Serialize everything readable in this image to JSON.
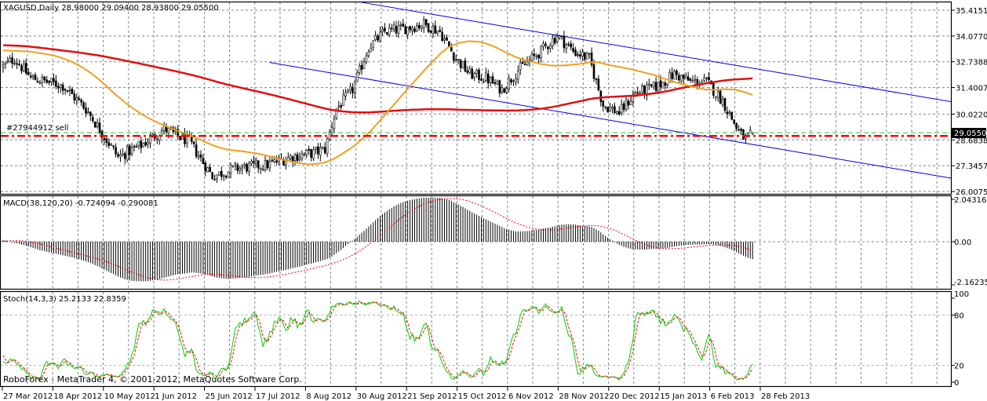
{
  "header": {
    "symbol": "XAGUSD,Daily",
    "open": "28.98000",
    "high": "29.09400",
    "low": "28.93800",
    "close": "29.05500"
  },
  "order_label": "#27944912 sell",
  "current_price_label": "29.05500",
  "copyright": "RoboForex - MetaTrader 4, © 2001-2012, MetaQuotes Software Corp.",
  "colors": {
    "ma_slow": "#e01010",
    "ma_fast": "#f0a020",
    "trendline": "#0000e0",
    "order_line": "#ff0000",
    "bid_line": "#30c030",
    "stoch_main": "#00d000",
    "stoch_signal": "#ff0000",
    "macd_hist": "#000000",
    "macd_signal": "#ff0000"
  },
  "chart_data": [
    {
      "type": "candlestick",
      "title": "XAGUSD,Daily",
      "price_ticks": [
        "35.41515",
        "34.07700",
        "32.73885",
        "31.40070",
        "30.02200",
        "28.68385",
        "27.34570",
        "26.00755"
      ],
      "ylim": [
        26.00755,
        35.41515
      ],
      "x_ticks": [
        "27 Mar 2012",
        "18 Apr 2012",
        "10 May 2012",
        "1 Jun 2012",
        "25 Jun 2012",
        "17 Jul 2012",
        "8 Aug 2012",
        "30 Aug 2012",
        "21 Sep 2012",
        "15 Oct 2012",
        "6 Nov 2012",
        "28 Nov 2012",
        "20 Dec 2012",
        "15 Jan 2013",
        "6 Feb 2013",
        "28 Feb 2013"
      ],
      "bars_per_tick": 22,
      "close_keypoints": [
        [
          0,
          32.5
        ],
        [
          5,
          32.9
        ],
        [
          12,
          31.9
        ],
        [
          26,
          31.5
        ],
        [
          36,
          30.3
        ],
        [
          50,
          27.8
        ],
        [
          60,
          28.4
        ],
        [
          70,
          29.25
        ],
        [
          81,
          28.6
        ],
        [
          91,
          26.8
        ],
        [
          101,
          27.2
        ],
        [
          115,
          27.4
        ],
        [
          125,
          27.8
        ],
        [
          135,
          28.0
        ],
        [
          140,
          28.2
        ],
        [
          145,
          30.3
        ],
        [
          152,
          31.3
        ],
        [
          159,
          33.5
        ],
        [
          166,
          34.3
        ],
        [
          176,
          34.5
        ],
        [
          183,
          34.7
        ],
        [
          190,
          34.3
        ],
        [
          197,
          32.9
        ],
        [
          203,
          32.1
        ],
        [
          210,
          31.9
        ],
        [
          217,
          31.3
        ],
        [
          224,
          32.3
        ],
        [
          234,
          33.3
        ],
        [
          241,
          34.1
        ],
        [
          248,
          33.3
        ],
        [
          255,
          32.9
        ],
        [
          261,
          30.5
        ],
        [
          268,
          30.1
        ],
        [
          275,
          31.1
        ],
        [
          285,
          31.5
        ],
        [
          292,
          32.1
        ],
        [
          299,
          31.7
        ],
        [
          306,
          31.7
        ],
        [
          313,
          30.7
        ],
        [
          320,
          29.1
        ],
        [
          323,
          28.7
        ],
        [
          326,
          29.055
        ]
      ],
      "last_bar": {
        "open": 28.98,
        "high": 29.094,
        "low": 28.938,
        "close": 29.055
      },
      "prehistory_level": 33.9,
      "moving_averages": [
        {
          "name": "MA slow",
          "period": 200
        },
        {
          "name": "MA fast",
          "period": 50
        }
      ],
      "trendlines": [
        {
          "from": [
            156,
            35.82
          ],
          "to": [
            413,
            30.67
          ]
        },
        {
          "from": [
            116,
            32.7
          ],
          "to": [
            413,
            26.7
          ]
        }
      ],
      "order_price": 28.93,
      "bid_price": 29.055
    },
    {
      "type": "macd",
      "label": "MACD(38,120,20) -0.724094 -0.290081",
      "params": [
        38,
        120,
        20
      ],
      "ticks": [
        "2.043163",
        "0.00",
        "-2.162353"
      ],
      "ylim": [
        -2.162353,
        2.043163
      ]
    },
    {
      "type": "stochastic",
      "label": "Stoch(14,3,3) 25.2133 22.8359",
      "params": [
        14,
        3,
        3
      ],
      "ticks": [
        "100",
        "80",
        "20",
        "0"
      ],
      "ylim": [
        0,
        100
      ]
    }
  ]
}
